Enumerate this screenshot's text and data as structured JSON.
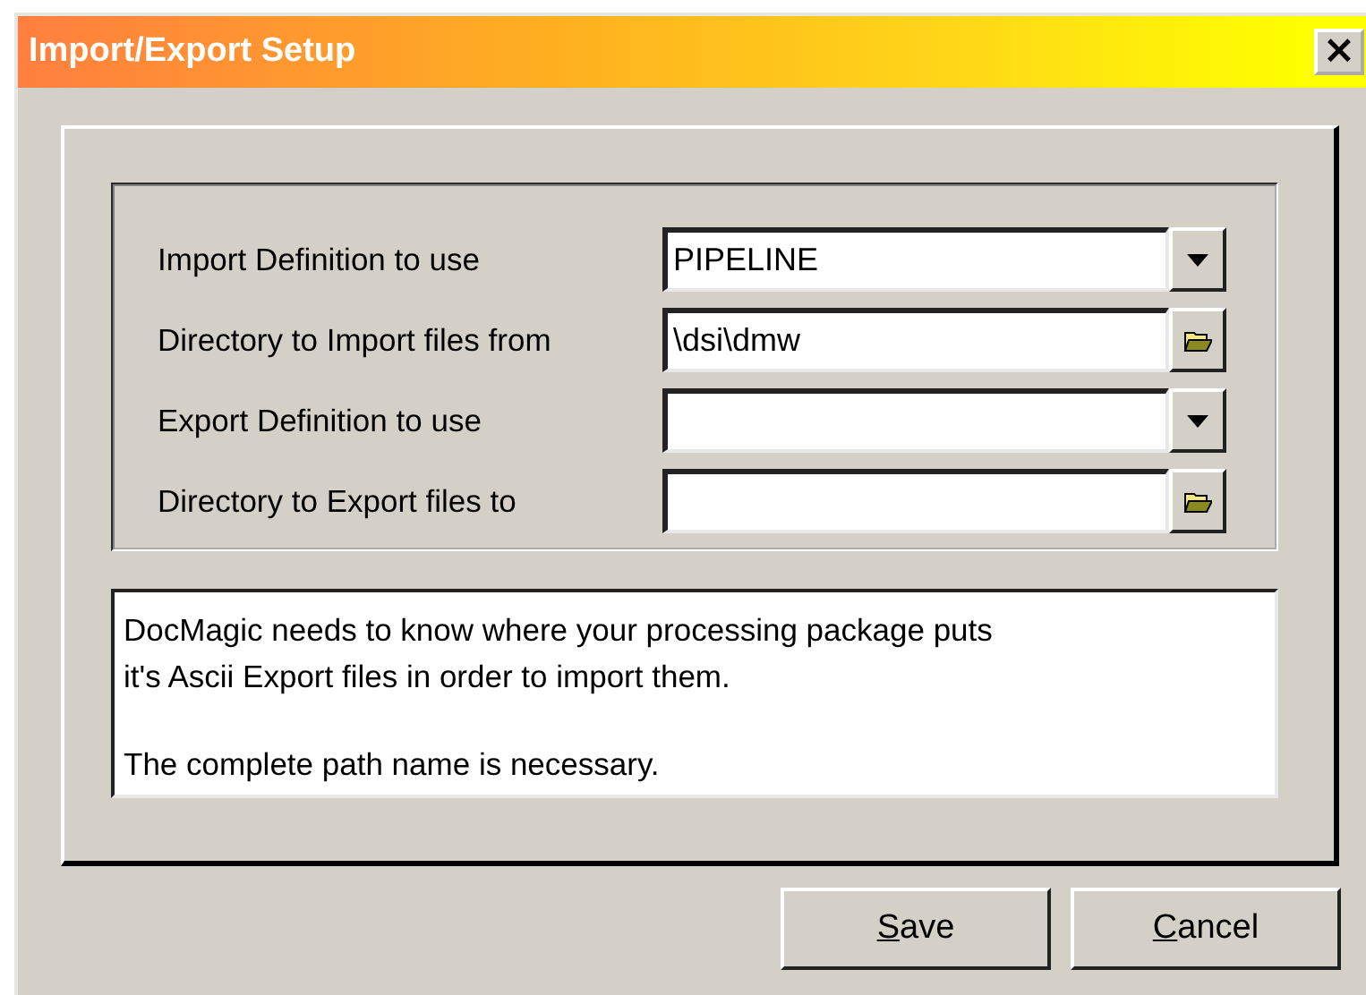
{
  "window": {
    "title": "Import/Export Setup",
    "close": "×"
  },
  "settings": [
    {
      "label": "Import Definition to use",
      "value": "PIPELINE",
      "kind": "dropdown"
    },
    {
      "label": "Directory to Import files from",
      "value": "\\dsi\\dmw",
      "kind": "folder"
    },
    {
      "label": "Export Definition to use",
      "kind": "dropdown"
    },
    {
      "label": "Directory to Export files to",
      "kind": "folder"
    }
  ],
  "description": [
    [
      "DocMagic needs to know where your processing package puts",
      "it's Ascii Export files in order to import them."
    ],
    [
      "The complete path name is necessary."
    ]
  ],
  "buttons": [
    {
      "label": "Save"
    },
    {
      "label": "Cancel"
    }
  ]
}
